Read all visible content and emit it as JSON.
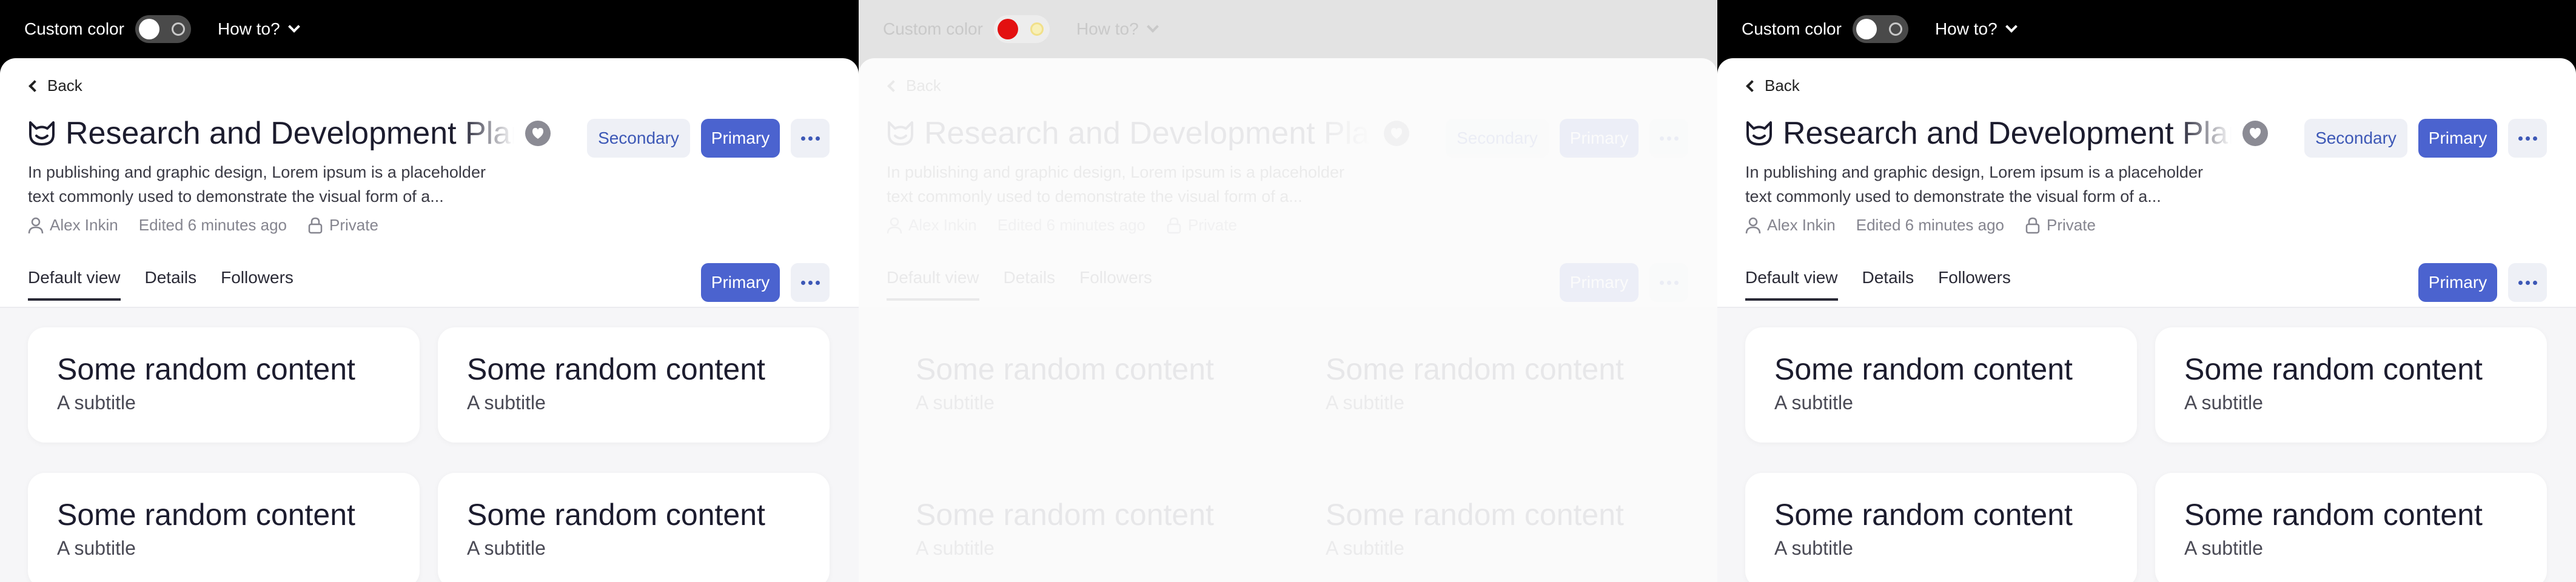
{
  "top_bar": {
    "custom_color_label": "Custom color",
    "how_to_label": "How to?"
  },
  "header": {
    "back_label": "Back",
    "title": "Research and Development Plan",
    "description": "In publishing and graphic design, Lorem ipsum is a placeholder text commonly used to demonstrate the visual form of a...",
    "author": "Alex Inkin",
    "edited": "Edited 6 minutes ago",
    "visibility": "Private",
    "secondary_label": "Secondary",
    "primary_label": "Primary"
  },
  "tabs": [
    {
      "label": "Default view",
      "active": true
    },
    {
      "label": "Details",
      "active": false
    },
    {
      "label": "Followers",
      "active": false
    }
  ],
  "tab_bar": {
    "primary_label": "Primary"
  },
  "cards": [
    {
      "title": "Some random content",
      "subtitle": "A subtitle"
    },
    {
      "title": "Some random content",
      "subtitle": "A subtitle"
    },
    {
      "title": "Some random content",
      "subtitle": "A subtitle"
    },
    {
      "title": "Some random content",
      "subtitle": "A subtitle"
    }
  ],
  "panels": [
    {
      "variant": "default",
      "toggle_on": false,
      "top_bar": "black"
    },
    {
      "variant": "custom-color",
      "toggle_on": true,
      "top_bar": "light gray",
      "toggle_knob_color": "#e31010"
    },
    {
      "variant": "default",
      "toggle_on": false,
      "top_bar": "black"
    }
  ],
  "colors": {
    "accent": "#4b63cf",
    "secondary_bg": "#eef0f6",
    "text": "#1c1c2e",
    "muted": "#85858f"
  }
}
